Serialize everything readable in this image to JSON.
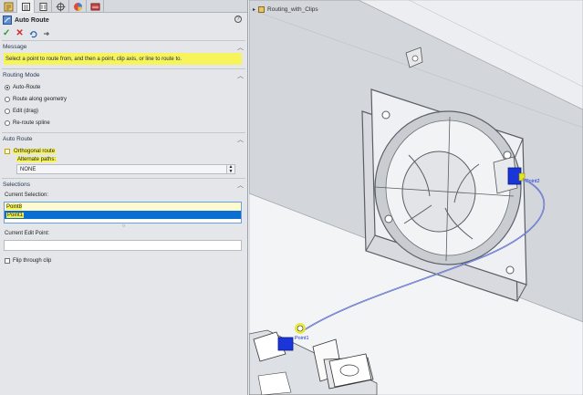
{
  "panel": {
    "title": "Auto Route",
    "help": "?",
    "actions": {
      "ok": "✓",
      "cancel": "✕"
    },
    "message": {
      "header": "Message",
      "text": "Select a point to route from, and then a point, clip axis, or line to route to."
    },
    "routing_mode": {
      "header": "Routing Mode",
      "options": [
        {
          "label": "Auto-Route",
          "checked": true
        },
        {
          "label": "Route along geometry",
          "checked": false
        },
        {
          "label": "Edit (drag)",
          "checked": false
        },
        {
          "label": "Re-route spline",
          "checked": false
        }
      ]
    },
    "auto_route": {
      "header": "Auto Route",
      "orthogonal_label": "Orthogonal route",
      "alternate_label": "Alternate paths:",
      "alternate_value": "NONE"
    },
    "selections": {
      "header": "Selections",
      "current_label": "Current Selection:",
      "items": [
        "Point8",
        "Point1"
      ],
      "edit_label": "Current Edit Point:",
      "flip_label": "Flip through clip"
    }
  },
  "viewport": {
    "breadcrumb": "Routing_with_Clips",
    "labels": {
      "point1": "Point1",
      "point2": "Point2"
    },
    "colors": {
      "wire": "#4e5fc2",
      "connector": "#1a35d8",
      "highlight": "#e6e61c"
    }
  }
}
